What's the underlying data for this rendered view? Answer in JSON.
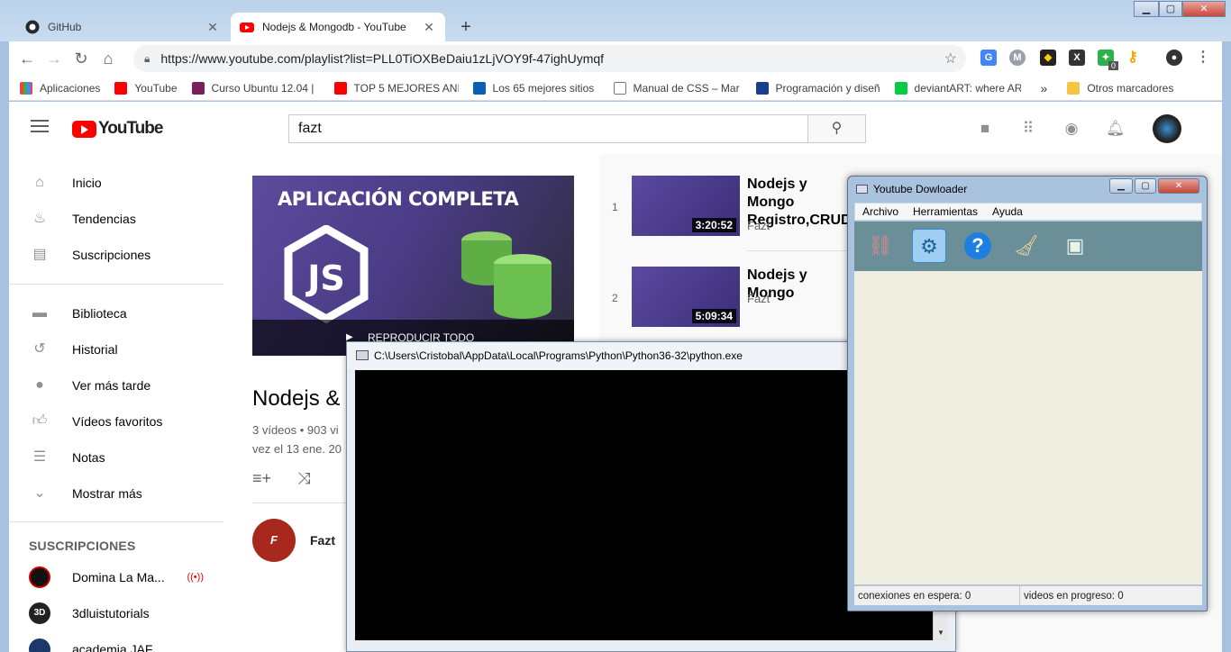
{
  "browser": {
    "tabs": [
      {
        "label": "GitHub",
        "active": false
      },
      {
        "label": "Nodejs & Mongodb - YouTube",
        "active": true
      }
    ],
    "url": "https://www.youtube.com/playlist?list=PLL0TiOXBeDaiu1zLjVOY9f-47ighUymqf",
    "extension_badge": "0",
    "bookmarks": [
      "Aplicaciones",
      "YouTube",
      "Curso Ubuntu 12.04 |",
      "TOP 5 MEJORES ANI",
      "Los 65 mejores sitios",
      "Manual de CSS – Mar",
      "Programación y diseñ",
      "deviantART: where AR"
    ],
    "bookmarks_overflow": "»",
    "other_bookmarks": "Otros marcadores"
  },
  "youtube": {
    "logo": "YouTube",
    "search_value": "fazt",
    "sidebar": [
      {
        "label": "Inicio",
        "icon": "home-icon"
      },
      {
        "label": "Tendencias",
        "icon": "fire-icon"
      },
      {
        "label": "Suscripciones",
        "icon": "subscriptions-icon"
      },
      {
        "label": "Biblioteca",
        "icon": "folder-icon"
      },
      {
        "label": "Historial",
        "icon": "history-icon"
      },
      {
        "label": "Ver más tarde",
        "icon": "clock-icon"
      },
      {
        "label": "Vídeos favoritos",
        "icon": "thumbs-up-icon"
      },
      {
        "label": "Notas",
        "icon": "playlist-icon"
      },
      {
        "label": "Mostrar más",
        "icon": "chevron-down-icon"
      }
    ],
    "subscriptions_title": "SUSCRIPCIONES",
    "subscriptions": [
      {
        "label": "Domina La Ma...",
        "live": true
      },
      {
        "label": "3dluistutorials",
        "live": false
      },
      {
        "label": "academia JAF",
        "live": false
      }
    ],
    "playlist": {
      "thumb_text": "APLICACIÓN COMPLETA",
      "play_all": "REPRODUCIR TODO",
      "title": "Nodejs &",
      "stats_line1": "3 vídeos •  903 vi",
      "stats_line2": "vez el 13 ene. 20",
      "owner": "Fazt"
    },
    "videos": [
      {
        "index": "1",
        "title_line1": "Nodejs y Mongo",
        "title_line2": "Registro,CRUD,",
        "duration": "3:20:52",
        "channel": "Fazt"
      },
      {
        "index": "2",
        "title_line1": "Nodejs y Mongo",
        "title_line2": "",
        "duration": "5:09:34",
        "channel": "Fazt"
      }
    ]
  },
  "console": {
    "title": "C:\\Users\\Cristobal\\AppData\\Local\\Programs\\Python\\Python36-32\\python.exe"
  },
  "ytd": {
    "title": "Youtube Dowloader",
    "menu": [
      "Archivo",
      "Herramientas",
      "Ayuda"
    ],
    "tools": [
      "add-link-icon",
      "settings-icon",
      "help-icon",
      "clean-icon",
      "download-server-icon"
    ],
    "status_waiting": "conexiones en espera: 0",
    "status_progress": "videos en progreso: 0"
  }
}
